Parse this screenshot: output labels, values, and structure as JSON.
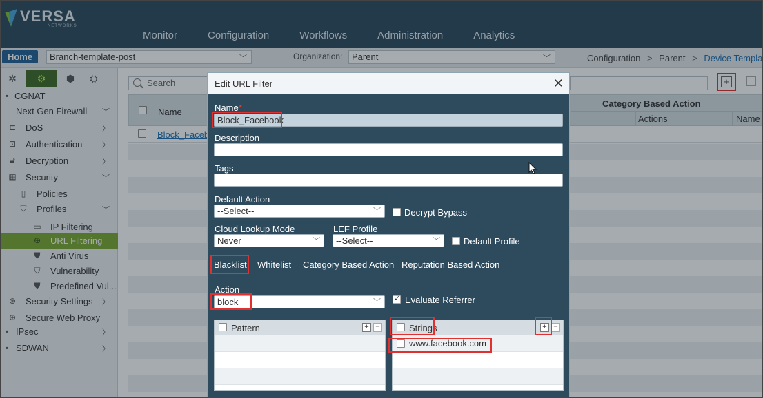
{
  "brand": {
    "name": "VERSA",
    "sub": "NETWORKS",
    "color": "#2c4a5e"
  },
  "nav": [
    "Monitor",
    "Configuration",
    "Workflows",
    "Administration",
    "Analytics"
  ],
  "context_bar": {
    "home_label": "Home",
    "template_value": "Branch-template-post",
    "org_label": "Organization:",
    "org_value": "Parent",
    "breadcrumb": [
      "Configuration",
      "Parent",
      "Device Templa"
    ]
  },
  "sidebar": {
    "tab_icons": [
      "network-icon",
      "gear-icon",
      "cube-icon",
      "settings-gear-icon"
    ],
    "items": [
      {
        "label": "CGNAT",
        "icon": "cgnat-icon"
      },
      {
        "label": "Next Gen Firewall",
        "icon": ""
      },
      {
        "label": "DoS",
        "icon": "dos-icon"
      },
      {
        "label": "Authentication",
        "icon": "authentication-icon"
      },
      {
        "label": "Decryption",
        "icon": "lock-open-icon"
      },
      {
        "label": "Security",
        "icon": "security-icon"
      },
      {
        "label": "Policies",
        "icon": "policies-icon"
      },
      {
        "label": "Profiles",
        "icon": "shield-icon"
      },
      {
        "label": "IP Filtering",
        "icon": "ip-filter-icon"
      },
      {
        "label": "URL Filtering",
        "icon": "globe-icon"
      },
      {
        "label": "Anti Virus",
        "icon": "antivirus-icon"
      },
      {
        "label": "Vulnerability",
        "icon": "vulnerability-icon"
      },
      {
        "label": "Predefined Vul...",
        "icon": "shield-icon"
      },
      {
        "label": "Security Settings",
        "icon": "security-settings-icon"
      },
      {
        "label": "Secure Web Proxy",
        "icon": "globe-icon"
      },
      {
        "label": "IPsec",
        "icon": "ipsec-icon"
      },
      {
        "label": "SDWAN",
        "icon": "sdwan-icon"
      }
    ]
  },
  "main": {
    "search_placeholder": "Search",
    "columns": {
      "name": "Name",
      "category_based_action": "Category Based Action",
      "actions": "Actions",
      "name2": "Name"
    },
    "rows": [
      {
        "name": "Block_Facebo"
      }
    ]
  },
  "modal": {
    "title": "Edit URL Filter",
    "name_label": "Name",
    "name_required": "*",
    "name_value": "Block_Facebook",
    "description_label": "Description",
    "description_value": "",
    "tags_label": "Tags",
    "tags_value": "",
    "default_action_label": "Default Action",
    "default_action_value": "--Select--",
    "decrypt_bypass_label": "Decrypt Bypass",
    "decrypt_bypass_checked": false,
    "cloud_lookup_label": "Cloud Lookup Mode",
    "cloud_lookup_value": "Never",
    "lef_profile_label": "LEF Profile",
    "lef_profile_value": "--Select--",
    "default_profile_label": "Default Profile",
    "default_profile_checked": false,
    "tabs": [
      "Blacklist",
      "Whitelist",
      "Category Based Action",
      "Reputation Based Action"
    ],
    "active_tab": "Blacklist",
    "action_label": "Action",
    "action_value": "block",
    "evaluate_referrer_label": "Evaluate Referrer",
    "evaluate_referrer_checked": true,
    "pattern_header": "Pattern",
    "strings_header": "Strings",
    "strings": [
      "www.facebook.com"
    ],
    "highlight_color": "#e03030"
  }
}
